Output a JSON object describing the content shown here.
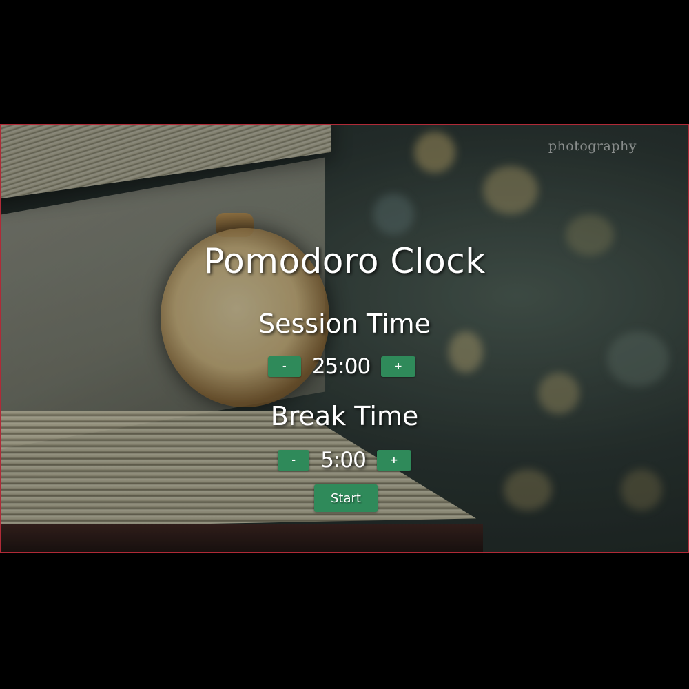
{
  "app": {
    "title": "Pomodoro Clock",
    "watermark": "photography"
  },
  "session": {
    "label": "Session Time",
    "value": "25:00",
    "decrement_label": "-",
    "increment_label": "+"
  },
  "break": {
    "label": "Break Time",
    "value": "5:00",
    "decrement_label": "-",
    "increment_label": "+"
  },
  "controls": {
    "start_label": "Start"
  },
  "colors": {
    "button": "#2f8a5a",
    "text": "#ffffff",
    "background": "#000000",
    "frame_border": "#b02a37"
  }
}
